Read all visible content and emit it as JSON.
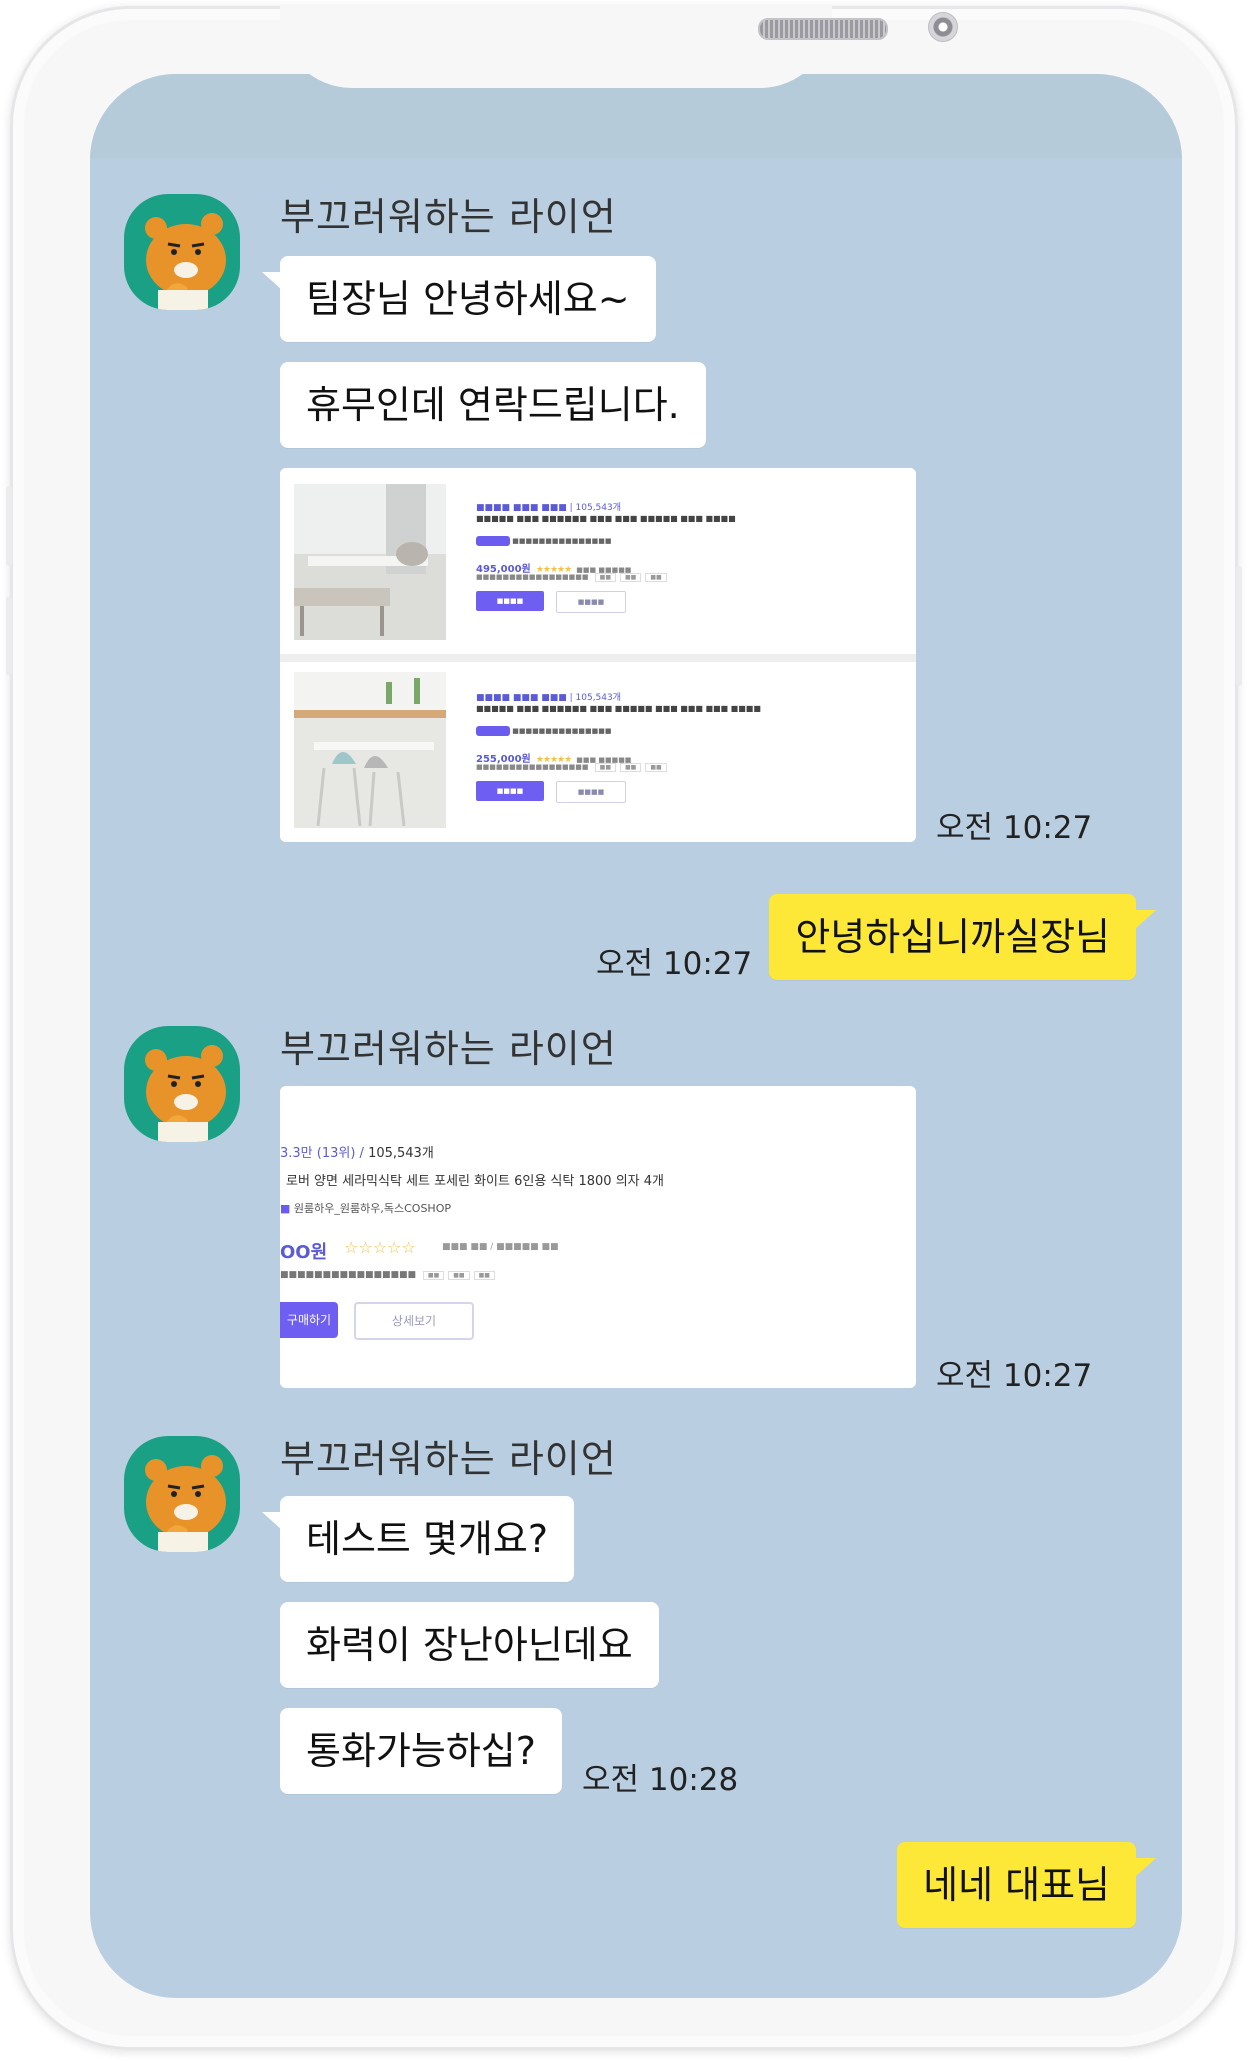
{
  "chat": {
    "messages": [
      {
        "sender": "부끄러워하는 라이언",
        "lines": [
          "팀장님 안녕하세요~",
          "휴무인데 연락드립니다."
        ]
      },
      {
        "image_time": "오전 10:27"
      },
      {
        "mine": "안녕하십니까실장님",
        "time": "오전 10:27"
      },
      {
        "sender": "부끄러워하는 라이언",
        "image_time": "오전 10:27"
      },
      {
        "sender": "부끄러워하는 라이언",
        "lines": [
          "테스트 몇개요?",
          "화력이 장난아닌데요",
          "통화가능하십?"
        ],
        "time": "오전 10:28"
      },
      {
        "mine": "네네 대표님"
      }
    ]
  },
  "cards": {
    "first": {
      "products": [
        {
          "count": "105,543개",
          "price": "495,000원"
        },
        {
          "count": "105,543개",
          "price": "255,000원"
        }
      ]
    },
    "second": {
      "count": "105,543개",
      "title": "로버 양면 세라믹식탁 세트 포세린 화이트 6인용 식탁 1800 의자 4개",
      "shop": "원룸하우_원룸하우,독스COSHOP",
      "price": "OO원",
      "buy_label": "구매하기",
      "more_label": "상세보기"
    }
  },
  "colors": {
    "chat_bg": "#b9cfe1",
    "my_bubble": "#fde838",
    "other_bubble": "#ffffff",
    "avatar_bg": "#1aa084"
  },
  "icons": {
    "avatar": "ryan-avatar-icon"
  }
}
